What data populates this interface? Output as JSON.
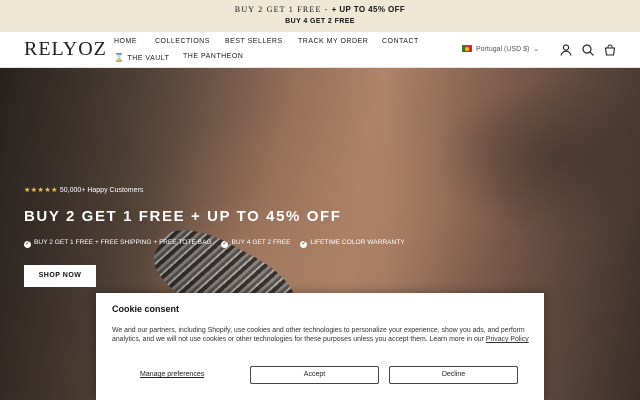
{
  "announcement": {
    "line1_prefix": "BUY 2 GET 1 FREE",
    "line1_sep": " - ",
    "line1_highlight": "+ UP TO 45% OFF",
    "line2": "BUY 4 GET 2 FREE"
  },
  "header": {
    "logo": "RELYOZ",
    "nav": [
      {
        "label": "HOME"
      },
      {
        "label": "COLLECTIONS"
      },
      {
        "label": "BEST SELLERS"
      },
      {
        "label": "TRACK MY ORDER"
      },
      {
        "label": "CONTACT"
      },
      {
        "label": "THE VAULT",
        "icon": "hourglass-icon"
      },
      {
        "label": "THE PANTHEON"
      }
    ],
    "locale": "Portugal (USD $)",
    "icons": [
      "account-icon",
      "search-icon",
      "cart-icon"
    ]
  },
  "hero": {
    "stars": "★★★★★",
    "rating_text": "50,000+ Happy Customers",
    "headline": "BUY 2 GET 1 FREE + UP TO 45% OFF",
    "perks": [
      "BUY 2 GET 1 FREE + FREE SHIPPING + FREE TOTE BAG",
      "BUY 4 GET 2 FREE",
      "LIFETIME COLOR WARRANTY"
    ],
    "cta": "SHOP NOW"
  },
  "cookie": {
    "title": "Cookie consent",
    "body": "We and our partners, including Shopify, use cookies and other technologies to personalize your experience, show you ads, and perform analytics, and we will not use cookies or other technologies for these purposes unless you accept them. Learn more in our",
    "policy_link": "Privacy Policy",
    "manage": "Manage preferences",
    "accept": "Accept",
    "decline": "Decline"
  },
  "colors": {
    "announcement_bg": "#efe8d4",
    "star": "#f4c542",
    "text": "#111111"
  }
}
